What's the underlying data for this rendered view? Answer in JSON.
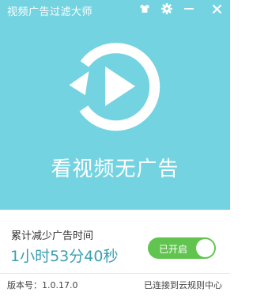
{
  "window": {
    "title": "视频广告过滤大师"
  },
  "hero": {
    "headline": "看视频无广告",
    "background_color": "#74d3e1",
    "logo_icon": "replay-play-icon"
  },
  "stats": {
    "label": "累计减少广告时间",
    "time": "1小时53分40秒",
    "time_color": "#3a9fb2"
  },
  "toggle": {
    "label": "已开启",
    "state": "on",
    "color": "#61c44f"
  },
  "footer": {
    "version": "版本号：1.0.17.0",
    "cloud_status": "已连接到云规则中心"
  },
  "icons": {
    "skin": "tshirt-icon",
    "settings": "gear-icon",
    "minimize": "minimize-icon",
    "close": "close-icon"
  }
}
